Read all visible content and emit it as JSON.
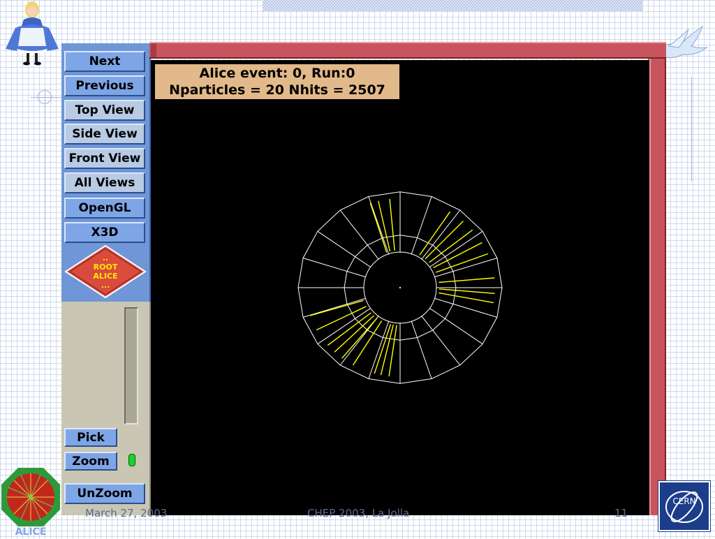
{
  "event_display": {
    "info_line1": "Alice event: 0, Run:0",
    "info_line2": "Nparticles = 20  Nhits = 2507",
    "detector_segments": 20,
    "hit_lines": 20
  },
  "panel": {
    "buttons": {
      "next": "Next",
      "previous": "Previous",
      "top_view": "Top View",
      "side_view": "Side View",
      "front_view": "Front View",
      "all_views": "All Views",
      "opengl": "OpenGL",
      "x3d": "X3D",
      "pick": "Pick",
      "zoom": "Zoom",
      "unzoom": "UnZoom"
    },
    "diamond": {
      "dots_top": "..",
      "line1": "ROOT",
      "line2": "ALICE",
      "dots_bottom": "..."
    }
  },
  "footer": {
    "date": "March 27, 2003",
    "conference": "CHEP 2003, La Jolla",
    "page": "11",
    "logo_left": "ALICE",
    "logo_right": "CERN"
  },
  "colors": {
    "panel": "#6f96d6",
    "button": "#7ea5e6",
    "frame": "#c8555e",
    "detector": "#ffffff",
    "hits": "#ffff00",
    "info_bg": "#e2b98a"
  }
}
